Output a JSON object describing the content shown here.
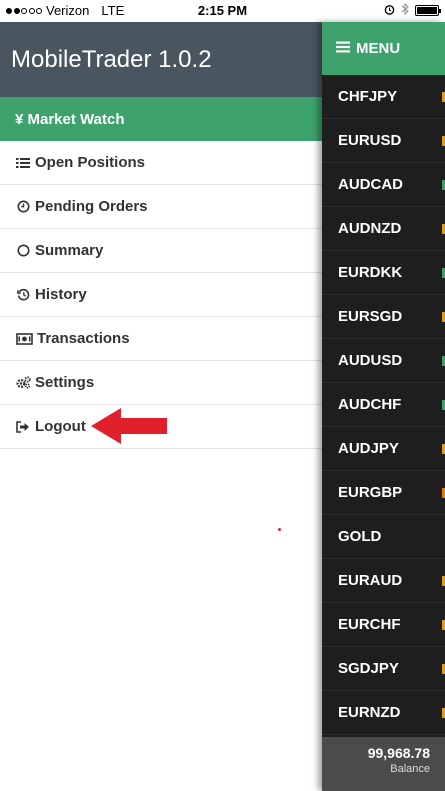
{
  "status_bar": {
    "carrier": "Verizon",
    "network": "LTE",
    "time": "2:15 PM"
  },
  "app_title": "MobileTrader 1.0.2",
  "menu_items": [
    {
      "label": "¥ Market Watch",
      "icon": ""
    },
    {
      "label": "Open Positions",
      "icon": "list-icon"
    },
    {
      "label": "Pending Orders",
      "icon": "clock-icon"
    },
    {
      "label": "Summary",
      "icon": "circle-icon"
    },
    {
      "label": "History",
      "icon": "history-icon"
    },
    {
      "label": "Transactions",
      "icon": "money-icon"
    },
    {
      "label": "Settings",
      "icon": "gears-icon"
    },
    {
      "label": "Logout",
      "icon": "logout-icon"
    }
  ],
  "menu_button_label": "MENU",
  "symbols": [
    "CHFJPY",
    "EURUSD",
    "AUDCAD",
    "AUDNZD",
    "EURDKK",
    "EURSGD",
    "AUDUSD",
    "AUDCHF",
    "AUDJPY",
    "EURGBP",
    "GOLD",
    "EURAUD",
    "EURCHF",
    "SGDJPY",
    "EURNZD"
  ],
  "symbol_edge_colors": [
    "#e39b1d",
    "#e39b1d",
    "#3da26b",
    "#e39b1d",
    "#3da26b",
    "#e39b1d",
    "#3da26b",
    "#3da26b",
    "#e39b1d",
    "#e07a12",
    "#1e1e1e",
    "#e39b1d",
    "#e39b1d",
    "#e39b1d",
    "#e39b1d"
  ],
  "balance": {
    "amount": "99,968.78",
    "label": "Balance"
  },
  "colors": {
    "header": "#4a565f",
    "accent": "#3da26b",
    "panel": "#1e1e1e",
    "arrow": "#e0202a"
  }
}
